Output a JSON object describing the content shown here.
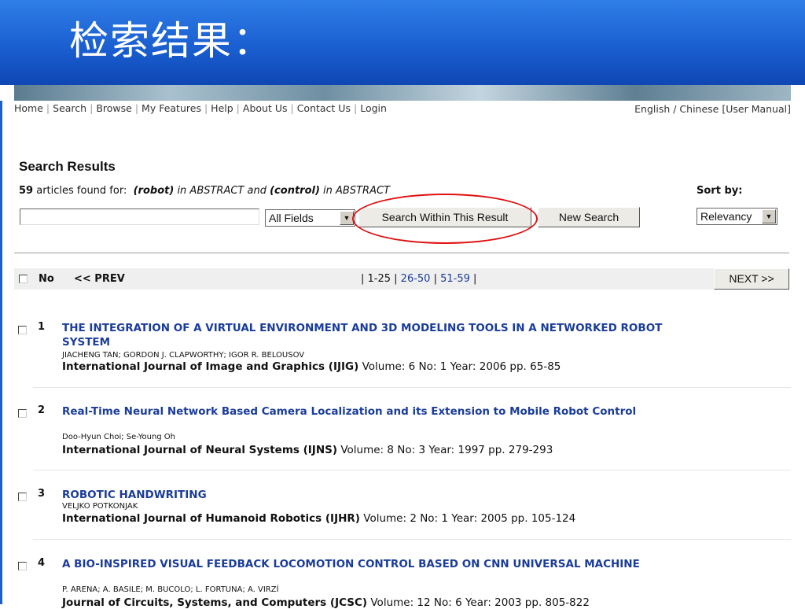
{
  "slide": {
    "title": "检索结果："
  },
  "nav": {
    "links": [
      "Home",
      "Search",
      "Browse",
      "My Features",
      "Help",
      "About Us",
      "Contact Us",
      "Login"
    ],
    "language": "English / Chinese [User Manual]"
  },
  "results_header": {
    "heading": "Search Results",
    "count": "59",
    "found_text": "articles found for:",
    "query_part1": "(robot)",
    "query_in1": "in ABSTRACT and",
    "query_part2": "(control)",
    "query_in2": "in ABSTRACT",
    "sort_label": "Sort by:"
  },
  "search": {
    "input_value": "",
    "field_select": "All Fields",
    "within_button": "Search Within This Result",
    "new_button": "New Search",
    "sort_select": "Relevancy"
  },
  "pagination": {
    "no_label": "No",
    "prev": "<< PREV",
    "pre": "| 1-25 |",
    "page2": "26-50",
    "sep": "|",
    "page3": "51-59",
    "post": "|",
    "next": "NEXT >>"
  },
  "results": [
    {
      "num": "1",
      "title": "THE INTEGRATION OF A VIRTUAL ENVIRONMENT AND 3D MODELING TOOLS IN A NETWORKED ROBOT SYSTEM",
      "authors": "JIACHENG TAN; GORDON J. CLAPWORTHY; IGOR R. BELOUSOV",
      "journal": "International Journal of Image and Graphics (IJIG)",
      "details": "Volume: 6 No: 1 Year: 2006 pp. 65-85"
    },
    {
      "num": "2",
      "title": "Real-Time Neural Network Based Camera Localization and its Extension to Mobile Robot Control",
      "authors": "Doo-Hyun Choi; Se-Young Oh",
      "journal": "International Journal of Neural Systems (IJNS)",
      "details": "Volume: 8 No: 3 Year: 1997 pp. 279-293"
    },
    {
      "num": "3",
      "title": "ROBOTIC HANDWRITING",
      "authors": "VELJKO POTKONJAK",
      "journal": "International Journal of Humanoid Robotics (IJHR)",
      "details": "Volume: 2 No: 1 Year: 2005 pp. 105-124"
    },
    {
      "num": "4",
      "title": "A BIO-INSPIRED VISUAL FEEDBACK LOCOMOTION CONTROL BASED ON CNN UNIVERSAL MACHINE",
      "authors": "P. ARENA; A. BASILE; M. BUCOLO; L. FORTUNA; A. VIRZÍ",
      "journal": "Journal of Circuits, Systems, and Computers (JCSC)",
      "details": "Volume: 12 No: 6 Year: 2003 pp. 805-822"
    }
  ]
}
